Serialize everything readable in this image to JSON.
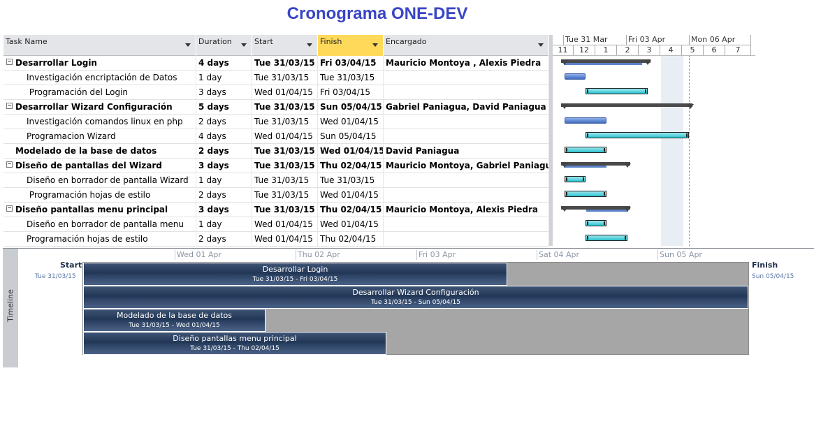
{
  "title": "Cronograma ONE-DEV",
  "columns": {
    "task_name": "Task Name",
    "duration": "Duration",
    "start": "Start",
    "finish": "Finish",
    "encargado": "Encargado"
  },
  "tasks": [
    {
      "name": "Desarrollar Login",
      "duration": "4 days",
      "start": "Tue 31/03/15",
      "finish": "Fri 03/04/15",
      "encargado": "Mauricio Montoya , Alexis Piedra",
      "summary": true
    },
    {
      "name": "Investigación encriptación de Datos",
      "duration": "1 day",
      "start": "Tue 31/03/15",
      "finish": "Tue 31/03/15",
      "encargado": "",
      "summary": false
    },
    {
      "name": " Programación del Login",
      "duration": "3 days",
      "start": "Wed 01/04/15",
      "finish": "Fri 03/04/15",
      "encargado": "",
      "summary": false
    },
    {
      "name": "Desarrollar Wizard Configuración",
      "duration": "5 days",
      "start": "Tue 31/03/15",
      "finish": "Sun 05/04/15",
      "encargado": "Gabriel Paniagua, David Paniagua",
      "summary": true
    },
    {
      "name": "Investigación comandos linux en php",
      "duration": "2 days",
      "start": "Tue 31/03/15",
      "finish": "Wed 01/04/15",
      "encargado": "",
      "summary": false
    },
    {
      "name": "Programacion Wizard",
      "duration": "4 days",
      "start": "Wed 01/04/15",
      "finish": "Sun 05/04/15",
      "encargado": "",
      "summary": false
    },
    {
      "name": "Modelado de la base de datos",
      "duration": "2 days",
      "start": "Tue 31/03/15",
      "finish": "Wed 01/04/15",
      "encargado": "David Paniagua",
      "summary": true
    },
    {
      "name": "Diseño de pantallas del Wizard",
      "duration": "3 days",
      "start": "Tue 31/03/15",
      "finish": "Thu 02/04/15",
      "encargado": "Mauricio Montoya, Gabriel Paniagua",
      "summary": true
    },
    {
      "name": "Diseño en borrador de pantalla Wizard",
      "duration": "1 day",
      "start": "Tue 31/03/15",
      "finish": "Tue 31/03/15",
      "encargado": "",
      "summary": false
    },
    {
      "name": " Programación hojas de estilo",
      "duration": "2 days",
      "start": "Tue 31/03/15",
      "finish": "Wed 01/04/15",
      "encargado": "",
      "summary": false
    },
    {
      "name": "Diseño pantallas menu principal",
      "duration": "3 days",
      "start": "Tue 31/03/15",
      "finish": "Thu 02/04/15",
      "encargado": "Mauricio Montoya, Alexis Piedra",
      "summary": true
    },
    {
      "name": "Diseño en borrador de pantalla menu",
      "duration": "1 day",
      "start": "Wed 01/04/15",
      "finish": "Wed 01/04/15",
      "encargado": "",
      "summary": false
    },
    {
      "name": "Programación hojas de estilo",
      "duration": "2 days",
      "start": "Wed 01/04/15",
      "finish": "Thu 02/04/15",
      "encargado": "",
      "summary": false
    }
  ],
  "gantt_header": {
    "weeks": [
      "Tue 31 Mar",
      "Fri 03 Apr",
      "Mon 06 Apr"
    ],
    "hours": [
      "11",
      "12",
      "1",
      "2",
      "3",
      "4",
      "5",
      "6",
      "7"
    ]
  },
  "timeline": {
    "label": "Timeline",
    "scale": [
      "Wed 01 Apr",
      "Thu 02 Apr",
      "Fri 03 Apr",
      "Sat 04 Apr",
      "Sun 05 Apr"
    ],
    "start_label": "Start",
    "start_date": "Tue 31/03/15",
    "finish_label": "Finish",
    "finish_date": "Sun 05/04/15",
    "bars": [
      {
        "name": "Desarrollar Login",
        "dates": "Tue 31/03/15 - Fri 03/04/15"
      },
      {
        "name": "Desarrollar Wizard Configuración",
        "dates": "Tue 31/03/15 - Sun 05/04/15"
      },
      {
        "name": "Modelado de la base de datos",
        "dates": "Tue 31/03/15 - Wed 01/04/15"
      },
      {
        "name": "Diseño pantallas menu principal",
        "dates": "Tue 31/03/15 - Thu 02/04/15"
      }
    ]
  }
}
